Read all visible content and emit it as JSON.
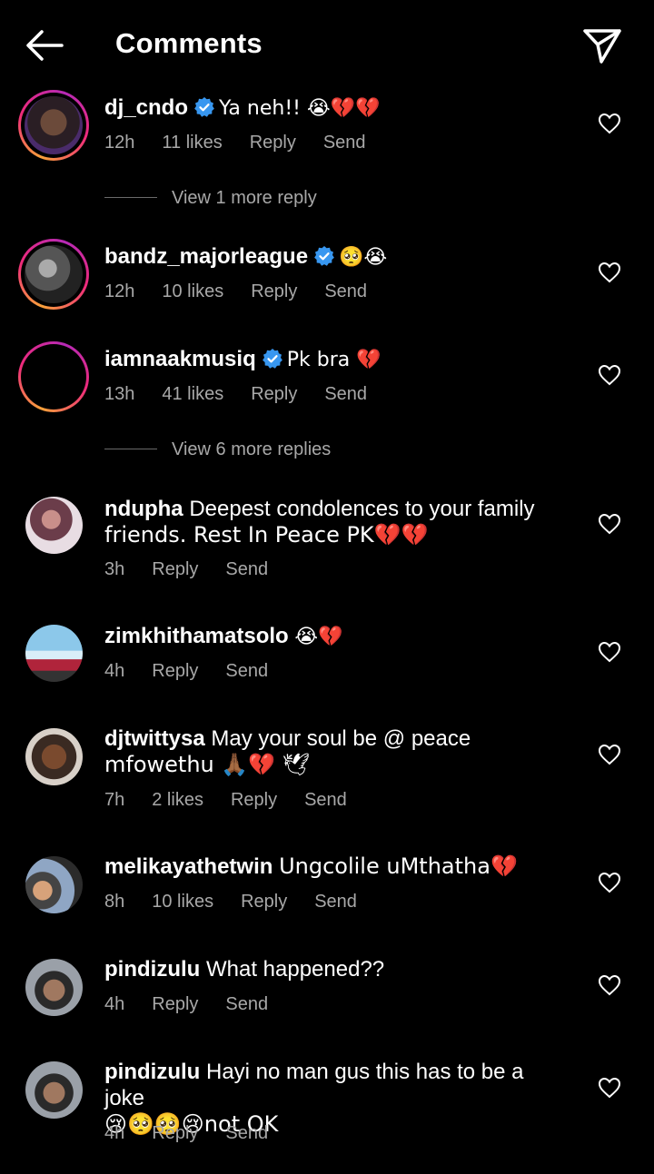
{
  "header": {
    "title": "Comments"
  },
  "meta_labels": {
    "reply": "Reply",
    "send": "Send"
  },
  "comments": [
    {
      "username": "dj_cndo",
      "verified": true,
      "text": "Ya neh!! 😭💔💔",
      "time": "12h",
      "likes": "11 likes",
      "view_more": "View 1 more reply"
    },
    {
      "username": "bandz_majorleague",
      "verified": true,
      "text": "🥺😭",
      "time": "12h",
      "likes": "10 likes"
    },
    {
      "username": "iamnaakmusiq",
      "verified": true,
      "text": "Pk bra 💔",
      "time": "13h",
      "likes": "41 likes",
      "view_more": "View 6 more replies"
    },
    {
      "username": "ndupha",
      "text_line1": "Deepest condolences to your family",
      "text_line2": "friends. Rest In Peace PK💔💔",
      "time": "3h"
    },
    {
      "username": "zimkhithamatsolo",
      "text": "😭💔",
      "time": "4h"
    },
    {
      "username": "djtwittysa",
      "text_line1": "May your soul be @ peace",
      "text_line2": "mfowethu 🙏🏾💔 🕊",
      "time": "7h",
      "likes": "2 likes"
    },
    {
      "username": "melikayathetwin",
      "text": "Ungcolile uMthatha💔",
      "time": "8h",
      "likes": "10 likes"
    },
    {
      "username": "pindizulu",
      "text": "What happened??",
      "time": "4h"
    },
    {
      "username": "pindizulu",
      "text_line1": "Hayi no man gus this has to be a joke",
      "text_line2": "😢🥺🥺😢not OK",
      "time": "4h"
    }
  ],
  "colors": {
    "background": "#000000",
    "meta": "#a8a8a8",
    "verified": "#3897f0",
    "story_ring": [
      "#f9a13a",
      "#ee2a7b",
      "#b62ab6"
    ]
  },
  "icons": [
    "arrow-left",
    "paper-plane",
    "heart-outline",
    "verified-badge"
  ]
}
